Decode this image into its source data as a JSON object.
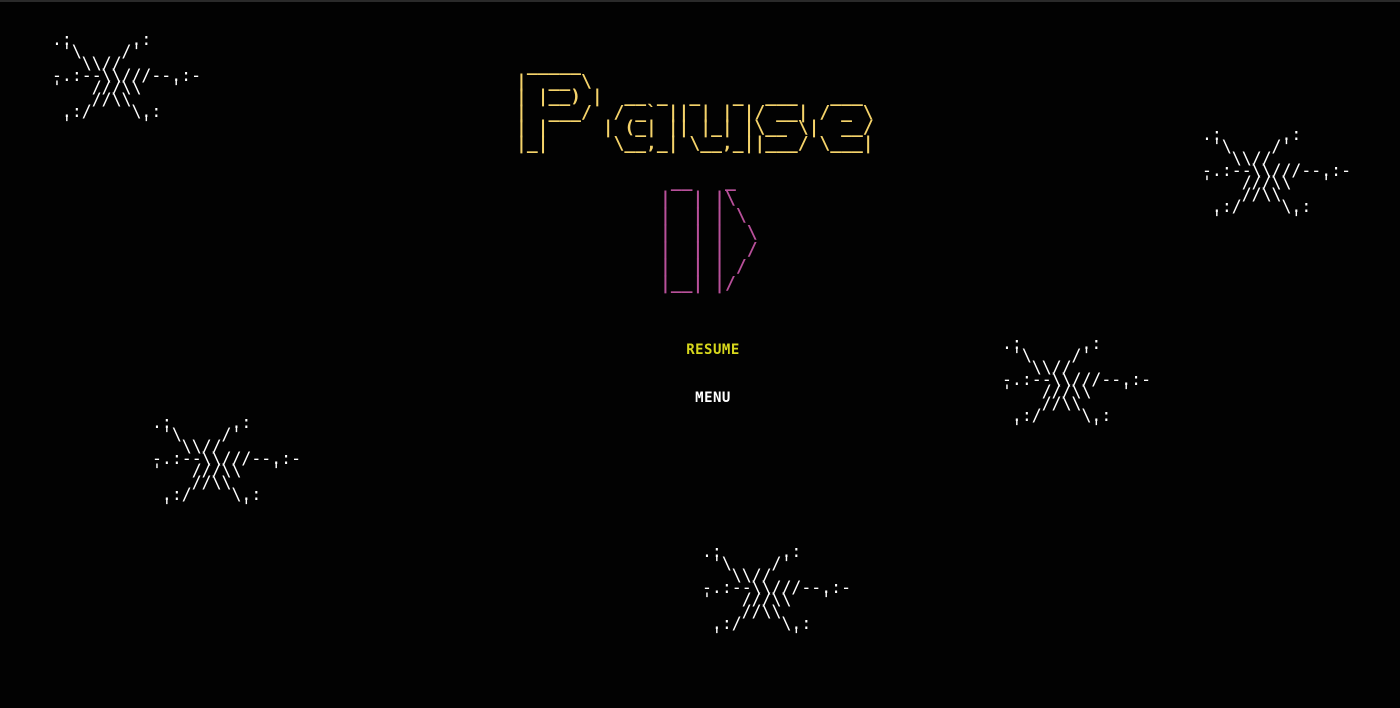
{
  "title": {
    "ascii_art": " _____\n|  __ \\\n| |__) |  __ _  _   _  ___   ___\n|  ___/  / _` || | | |/ __| / _ \\\n| |     | (_| || |_| |\\__ \\|  __/\n|_|      \\__,_| \\__,_||___/ \\___|",
    "text": "Pause",
    "color": "#f5d36a"
  },
  "pause_icon": {
    "ascii_art": " __   _\n|  | |\\\n|  | | \\\n|  | |  \\\n|  | |  /\n|  | | /\n|__| |/",
    "color": "#b8509a"
  },
  "menu": {
    "options": [
      {
        "label": "RESUME",
        "selected": true,
        "color": "#d8d81c"
      },
      {
        "label": "MENU",
        "selected": false,
        "color": "#ffffff"
      }
    ]
  },
  "snowflake": {
    "ascii_art": ".:      .:\n '\\    /'\n   \\\\//\n-.:--\\\\///--.:-\n'   ///\\\\   '\n    //\\\\\n .:/    \\.:\n '       '",
    "color": "#ffffff"
  }
}
